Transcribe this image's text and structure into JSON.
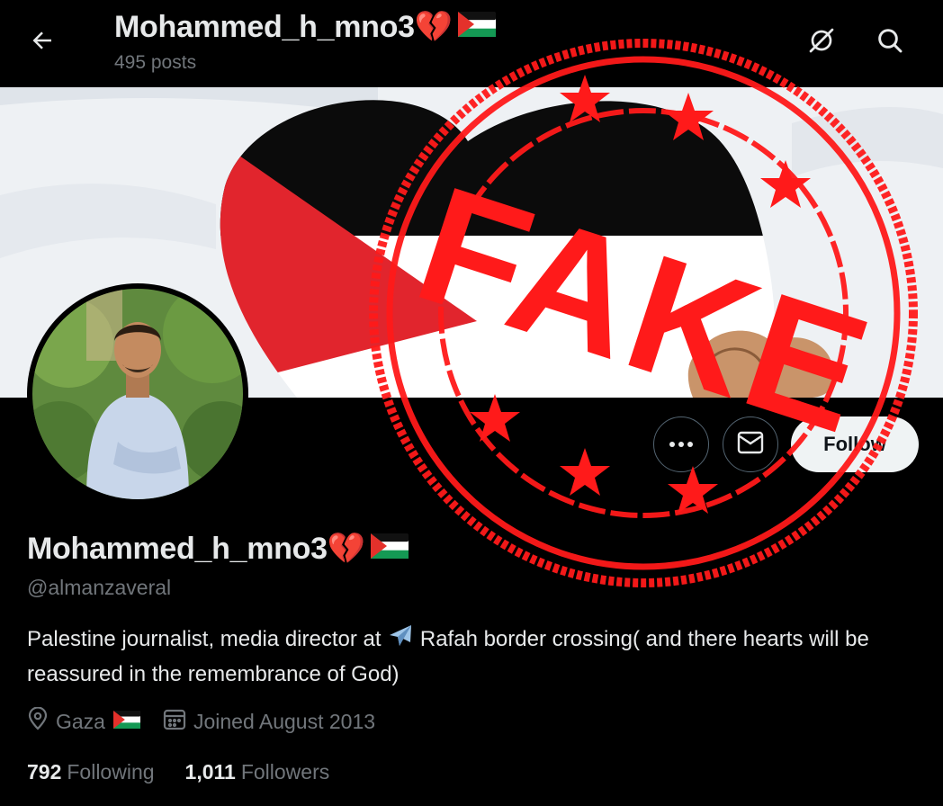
{
  "header": {
    "title": "Mohammed_h_mno3💔",
    "posts_count": "495 posts"
  },
  "icons": {
    "back": "arrow-left-icon",
    "grok": "grok-icon",
    "search": "search-icon",
    "more": "more-dots-icon",
    "message": "envelope-icon",
    "location": "location-pin-icon",
    "calendar": "calendar-icon"
  },
  "actions": {
    "follow_label": "Follow"
  },
  "profile": {
    "display_name": "Mohammed_h_mno3💔",
    "handle": "@almanzaveral",
    "bio_part1": "Palestine journalist, media director at ",
    "bio_part2": " Rafah border crossing( and there hearts will be reassured in the remembrance of God)",
    "location": "Gaza",
    "joined": "Joined August 2013",
    "following_count": "792",
    "following_label": "Following",
    "followers_count": "1,011",
    "followers_label": "Followers"
  },
  "overlay": {
    "stamp_text": "FAKE",
    "stamp_color": "#ff1a1a"
  },
  "colors": {
    "background": "#000000",
    "text_primary": "#e7e9ea",
    "text_secondary": "#71767b",
    "follow_bg": "#eff3f4"
  }
}
